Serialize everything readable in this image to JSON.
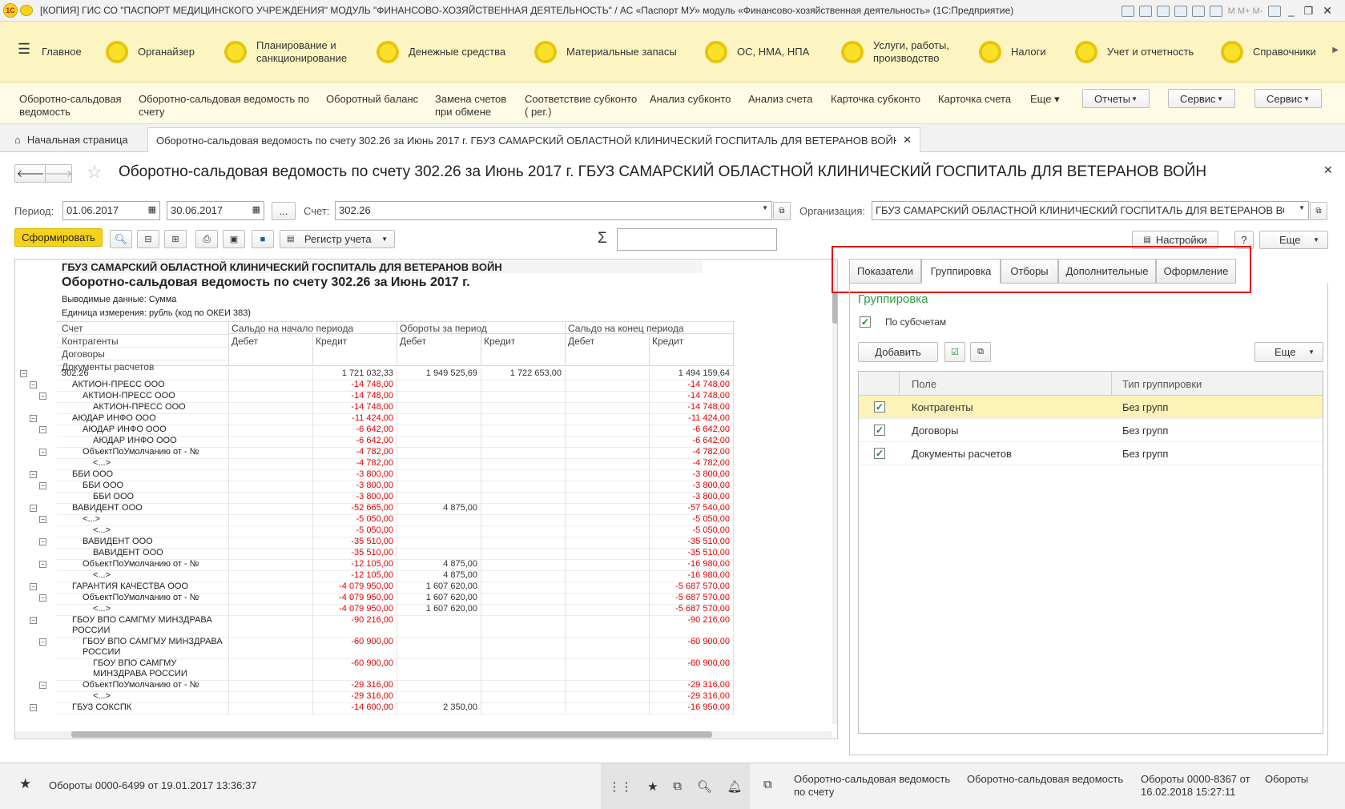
{
  "window": {
    "title": "[КОПИЯ] ГИС СО \"ПАСПОРТ МЕДИЦИНСКОГО УЧРЕЖДЕНИЯ\" МОДУЛЬ \"ФИНАНСОВО-ХОЗЯЙСТВЕННАЯ ДЕЯТЕЛЬНОСТЬ\" / АС «Паспорт МУ» модуль «Финансово-хозяйственная деятельность» (1С:Предприятие)"
  },
  "sections": [
    {
      "label": "Главное"
    },
    {
      "label": "Органайзер"
    },
    {
      "label": "Планирование и\nсанкционирование"
    },
    {
      "label": "Денежные средства"
    },
    {
      "label": "Материальные запасы"
    },
    {
      "label": "ОС, НМА, НПА"
    },
    {
      "label": "Услуги, работы,\nпроизводство"
    },
    {
      "label": "Налоги"
    },
    {
      "label": "Учет и отчетность"
    },
    {
      "label": "Справочники"
    }
  ],
  "nav": {
    "items": [
      "Оборотно-сальдовая\nведомость",
      "Оборотно-сальдовая ведомость по\nсчету",
      "Оборотный баланс",
      "Замена счетов\nпри обмене",
      "Соответствие субконто\n( рег.)",
      "Анализ субконто",
      "Анализ счета",
      "Карточка субконто",
      "Карточка счета",
      "Еще ▾"
    ],
    "buttons": [
      "Отчеты",
      "Сервис",
      "Сервис"
    ]
  },
  "tabs": {
    "home": "Начальная страница",
    "active": "Оборотно-сальдовая ведомость по счету 302.26 за Июнь 2017 г. ГБУЗ САМАРСКИЙ ОБЛАСТНОЙ КЛИНИЧЕСКИЙ ГОСПИТАЛЬ ДЛЯ ВЕТЕРАНОВ ВОЙН"
  },
  "form": {
    "title": "Оборотно-сальдовая ведомость по счету 302.26 за Июнь 2017 г. ГБУЗ САМАРСКИЙ ОБЛАСТНОЙ КЛИНИЧЕСКИЙ ГОСПИТАЛЬ ДЛЯ ВЕТЕРАНОВ ВОЙН",
    "period_label": "Период:",
    "date_from": "01.06.2017",
    "date_to": "30.06.2017",
    "dots": "...",
    "account_label": "Счет:",
    "account": "302.26",
    "org_label": "Организация:",
    "org": "ГБУЗ САМАРСКИЙ ОБЛАСТНОЙ КЛИНИЧЕСКИЙ ГОСПИТАЛЬ ДЛЯ ВЕТЕРАНОВ ВОЙН",
    "generate": "Сформировать",
    "register": "Регистр учета",
    "sigma": "Σ",
    "settings_btn": "Настройки",
    "help": "?",
    "more": "Еще"
  },
  "report": {
    "org": "ГБУЗ САМАРСКИЙ ОБЛАСТНОЙ КЛИНИЧЕСКИЙ ГОСПИТАЛЬ ДЛЯ ВЕТЕРАНОВ ВОЙН",
    "title": "Оборотно-сальдовая ведомость по счету 302.26 за Июнь 2017 г.",
    "data_line": "Выводимые данные:  Сумма",
    "unit_line": "Единица измерения: рубль (код по ОКЕИ 383)",
    "col_groups": [
      "Сальдо на начало периода",
      "Обороты за период",
      "Сальдо на конец периода"
    ],
    "sub_cols": [
      "Дебет",
      "Кредит",
      "Дебет",
      "Кредит",
      "Дебет",
      "Кредит"
    ],
    "dims": [
      "Счет",
      "Контрагенты",
      "Договоры",
      "Документы расчетов"
    ],
    "rows": [
      {
        "l": 0,
        "name": "302.26",
        "v": [
          "",
          "1 721 032,33",
          "1 949 525,69",
          "1 722 653,00",
          "",
          "1 494 159,64"
        ],
        "neg": false
      },
      {
        "l": 1,
        "name": "АКТИОН-ПРЕСС ООО",
        "v": [
          "",
          "-14 748,00",
          "",
          "",
          "",
          "-14 748,00"
        ],
        "neg": true
      },
      {
        "l": 2,
        "name": "АКТИОН-ПРЕСС ООО",
        "v": [
          "",
          "-14 748,00",
          "",
          "",
          "",
          "-14 748,00"
        ],
        "neg": true
      },
      {
        "l": 3,
        "name": "АКТИОН-ПРЕСС ООО",
        "v": [
          "",
          "-14 748,00",
          "",
          "",
          "",
          "-14 748,00"
        ],
        "neg": true
      },
      {
        "l": 1,
        "name": "АЮДАР ИНФО ООО",
        "v": [
          "",
          "-11 424,00",
          "",
          "",
          "",
          "-11 424,00"
        ],
        "neg": true
      },
      {
        "l": 2,
        "name": "АЮДАР ИНФО ООО",
        "v": [
          "",
          "-6 642,00",
          "",
          "",
          "",
          "-6 642,00"
        ],
        "neg": true
      },
      {
        "l": 3,
        "name": "АЮДАР ИНФО ООО",
        "v": [
          "",
          "-6 642,00",
          "",
          "",
          "",
          "-6 642,00"
        ],
        "neg": true
      },
      {
        "l": 2,
        "name": "ОбъектПоУмолчанию от - №",
        "v": [
          "",
          "-4 782,00",
          "",
          "",
          "",
          "-4 782,00"
        ],
        "neg": true
      },
      {
        "l": 3,
        "name": "<...>",
        "v": [
          "",
          "-4 782,00",
          "",
          "",
          "",
          "-4 782,00"
        ],
        "neg": true
      },
      {
        "l": 1,
        "name": "ББИ ООО",
        "v": [
          "",
          "-3 800,00",
          "",
          "",
          "",
          "-3 800,00"
        ],
        "neg": true
      },
      {
        "l": 2,
        "name": "ББИ ООО",
        "v": [
          "",
          "-3 800,00",
          "",
          "",
          "",
          "-3 800,00"
        ],
        "neg": true
      },
      {
        "l": 3,
        "name": "ББИ ООО",
        "v": [
          "",
          "-3 800,00",
          "",
          "",
          "",
          "-3 800,00"
        ],
        "neg": true
      },
      {
        "l": 1,
        "name": "ВАВИДЕНТ ООО",
        "v": [
          "",
          "-52 665,00",
          "4 875,00",
          "",
          "",
          "-57 540,00"
        ],
        "neg": true
      },
      {
        "l": 2,
        "name": "<...>",
        "v": [
          "",
          "-5 050,00",
          "",
          "",
          "",
          "-5 050,00"
        ],
        "neg": true
      },
      {
        "l": 3,
        "name": "<...>",
        "v": [
          "",
          "-5 050,00",
          "",
          "",
          "",
          "-5 050,00"
        ],
        "neg": true
      },
      {
        "l": 2,
        "name": "ВАВИДЕНТ ООО",
        "v": [
          "",
          "-35 510,00",
          "",
          "",
          "",
          "-35 510,00"
        ],
        "neg": true
      },
      {
        "l": 3,
        "name": "ВАВИДЕНТ ООО",
        "v": [
          "",
          "-35 510,00",
          "",
          "",
          "",
          "-35 510,00"
        ],
        "neg": true
      },
      {
        "l": 2,
        "name": "ОбъектПоУмолчанию от - №",
        "v": [
          "",
          "-12 105,00",
          "4 875,00",
          "",
          "",
          "-16 980,00"
        ],
        "neg": true
      },
      {
        "l": 3,
        "name": "<...>",
        "v": [
          "",
          "-12 105,00",
          "4 875,00",
          "",
          "",
          "-16 980,00"
        ],
        "neg": true
      },
      {
        "l": 1,
        "name": "ГАРАНТИЯ КАЧЕСТВА ООО",
        "v": [
          "",
          "-4 079 950,00",
          "1 607 620,00",
          "",
          "",
          "-5 687 570,00"
        ],
        "neg": true
      },
      {
        "l": 2,
        "name": "ОбъектПоУмолчанию от - №",
        "v": [
          "",
          "-4 079 950,00",
          "1 607 620,00",
          "",
          "",
          "-5 687 570,00"
        ],
        "neg": true
      },
      {
        "l": 3,
        "name": "<...>",
        "v": [
          "",
          "-4 079 950,00",
          "1 607 620,00",
          "",
          "",
          "-5 687 570,00"
        ],
        "neg": true
      },
      {
        "l": 1,
        "name": "ГБОУ ВПО САМГМУ МИНЗДРАВА\nРОССИИ",
        "v": [
          "",
          "-90 216,00",
          "",
          "",
          "",
          "-90 216,00"
        ],
        "neg": true
      },
      {
        "l": 2,
        "name": "ГБОУ ВПО САМГМУ МИНЗДРАВА\nРОССИИ",
        "v": [
          "",
          "-60 900,00",
          "",
          "",
          "",
          "-60 900,00"
        ],
        "neg": true
      },
      {
        "l": 3,
        "name": "ГБОУ ВПО САМГМУ\nМИНЗДРАВА РОССИИ",
        "v": [
          "",
          "-60 900,00",
          "",
          "",
          "",
          "-60 900,00"
        ],
        "neg": true
      },
      {
        "l": 2,
        "name": "ОбъектПоУмолчанию от - №",
        "v": [
          "",
          "-29 316,00",
          "",
          "",
          "",
          "-29 316,00"
        ],
        "neg": true
      },
      {
        "l": 3,
        "name": "<...>",
        "v": [
          "",
          "-29 316,00",
          "",
          "",
          "",
          "-29 316,00"
        ],
        "neg": true
      },
      {
        "l": 1,
        "name": "ГБУЗ СОКСПК",
        "v": [
          "",
          "-14 600,00",
          "2 350,00",
          "",
          "",
          "-16 950,00"
        ],
        "neg": true
      }
    ]
  },
  "settings": {
    "tabs": [
      "Показатели",
      "Группировка",
      "Отборы",
      "Дополнительные",
      "Оформление"
    ],
    "active_tab": "Группировка",
    "group_title": "Группировка",
    "by_subaccounts": "По субсчетам",
    "add": "Добавить",
    "more": "Еще",
    "col_field": "Поле",
    "col_type": "Тип группировки",
    "rows": [
      {
        "field": "Контрагенты",
        "type": "Без групп"
      },
      {
        "field": "Договоры",
        "type": "Без групп"
      },
      {
        "field": "Документы расчетов",
        "type": "Без групп"
      }
    ]
  },
  "status": {
    "left": "Обороты 0000-6499 от 19.01.2017 13:36:37",
    "history": [
      "Оборотно-сальдовая ведомость\nпо счету",
      "Оборотно-сальдовая ведомость",
      "Обороты 0000-8367 от\n16.02.2018 15:27:11",
      "Обороты"
    ]
  },
  "colors": {
    "accent_red": "#e00000",
    "highlight_box": "#e01010",
    "section_bg": "#fcf5c2",
    "group_title": "#2e9e3e",
    "generate_btn": "#f7d21a"
  }
}
